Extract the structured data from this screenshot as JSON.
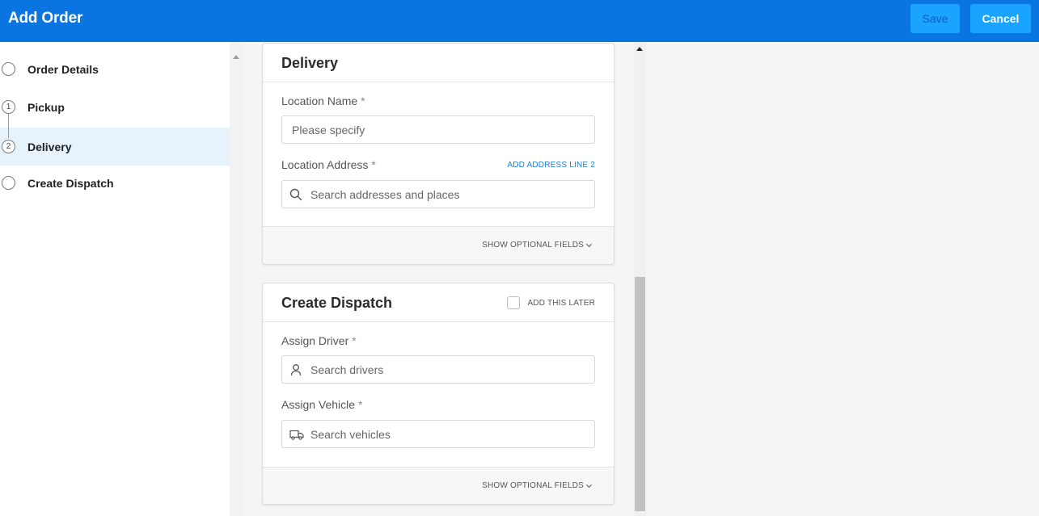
{
  "header": {
    "title": "Add Order",
    "save_label": "Save",
    "cancel_label": "Cancel"
  },
  "sidebar": {
    "steps": [
      {
        "label": "Order Details",
        "marker": ""
      },
      {
        "label": "Pickup",
        "marker": "1"
      },
      {
        "label": "Delivery",
        "marker": "2"
      },
      {
        "label": "Create Dispatch",
        "marker": ""
      }
    ],
    "active_step": "Delivery"
  },
  "delivery": {
    "title": "Delivery",
    "location_name_label": "Location Name",
    "location_name_placeholder": "Please specify",
    "location_address_label": "Location Address",
    "add_address_line_label": "ADD ADDRESS LINE 2",
    "location_address_placeholder": "Search addresses and places",
    "show_optional_label": "SHOW OPTIONAL FIELDS"
  },
  "dispatch": {
    "title": "Create Dispatch",
    "add_later_label": "ADD THIS LATER",
    "assign_driver_label": "Assign Driver",
    "assign_driver_placeholder": "Search drivers",
    "assign_vehicle_label": "Assign Vehicle",
    "assign_vehicle_placeholder": "Search vehicles",
    "show_optional_label": "SHOW OPTIONAL FIELDS"
  },
  "required_marker": "*",
  "colors": {
    "header": "#0a74e0",
    "button": "#1aa3ff",
    "active_step_bg": "#e6f2fc",
    "link": "#1a7fd6"
  }
}
